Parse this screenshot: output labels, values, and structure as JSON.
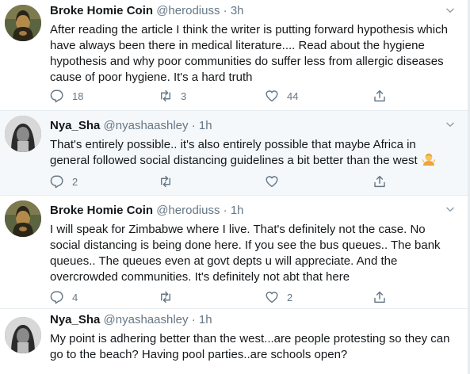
{
  "tweets": [
    {
      "name": "Broke Homie Coin",
      "handle": "@herodiuss",
      "dot": "·",
      "time": "3h",
      "text": "After reading the article I think the writer is putting forward hypothesis which have always been there in medical literature.... Read about the hygiene hypothesis and why poor communities do suffer less from allergic diseases cause of poor hygiene. It's a hard truth",
      "replies": "18",
      "retweets": "3",
      "likes": "44",
      "avatar_icon": "mona-lisa-avatar"
    },
    {
      "name": "Nya_Sha",
      "handle": "@nyashaashley",
      "dot": "·",
      "time": "1h",
      "text": "That's entirely possible.. it's also entirely possible that maybe Africa in general followed social distancing guidelines a bit better than the west",
      "emoji": "person-shrugging-emoji",
      "replies": "2",
      "retweets": "",
      "likes": "",
      "avatar_icon": "woman-portrait-avatar"
    },
    {
      "name": "Broke Homie Coin",
      "handle": "@herodiuss",
      "dot": "·",
      "time": "1h",
      "text": "I will speak for Zimbabwe where I live. That's definitely not the case. No social distancing is being done here. If you see the bus queues.. The bank queues.. The queues even at govt depts u will appreciate. And the overcrowded communities. It's definitely not abt that here",
      "replies": "4",
      "retweets": "",
      "likes": "2",
      "avatar_icon": "mona-lisa-avatar"
    },
    {
      "name": "Nya_Sha",
      "handle": "@nyashaashley",
      "dot": "·",
      "time": "1h",
      "text": "My point is adhering better than the west...are people protesting so they can go to the beach? Having pool parties..are schools open?",
      "avatar_icon": "woman-portrait-avatar"
    }
  ],
  "colors": {
    "text": "#14171a",
    "muted": "#657786",
    "highlight_bg": "#f5f8fa",
    "divider": "#e6ecf0"
  },
  "icons": [
    "reply-icon",
    "retweet-icon",
    "like-icon",
    "share-icon",
    "chevron-down-icon"
  ]
}
